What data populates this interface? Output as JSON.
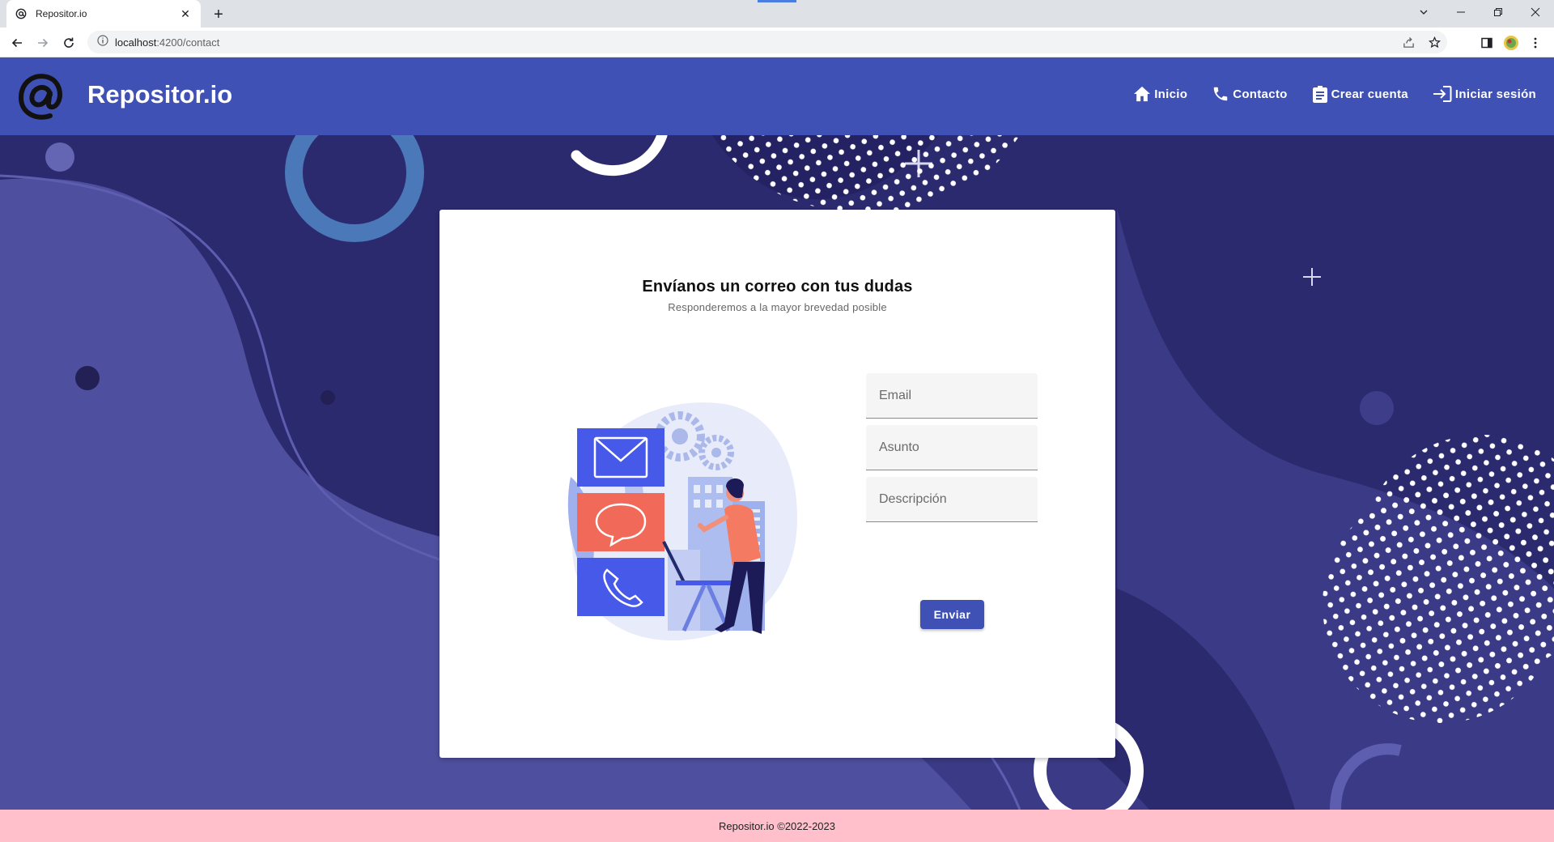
{
  "browser": {
    "tab_title": "Repositor.io",
    "url_host": "localhost",
    "url_rest": ":4200/contact",
    "new_tab_label": "+"
  },
  "header": {
    "brand": "Repositor.io",
    "nav": [
      {
        "label": "Inicio",
        "icon": "home-icon"
      },
      {
        "label": "Contacto",
        "icon": "phone-icon"
      },
      {
        "label": "Crear cuenta",
        "icon": "clipboard-icon"
      },
      {
        "label": "Iniciar sesión",
        "icon": "login-icon"
      }
    ]
  },
  "contact": {
    "title": "Envíanos un correo con tus dudas",
    "subtitle": "Responderemos a la mayor brevedad posible",
    "fields": {
      "email_placeholder": "Email",
      "subject_placeholder": "Asunto",
      "description_placeholder": "Descripción"
    },
    "submit_label": "Enviar"
  },
  "footer": {
    "text": "Repositor.io ©2022-2023"
  },
  "colors": {
    "header_bg": "#3f51b5",
    "background_dark": "#2c2a6e",
    "background_light": "#4e4f9f",
    "footer_bg": "#ffc0cb",
    "accent_coral": "#ee6a5a"
  }
}
